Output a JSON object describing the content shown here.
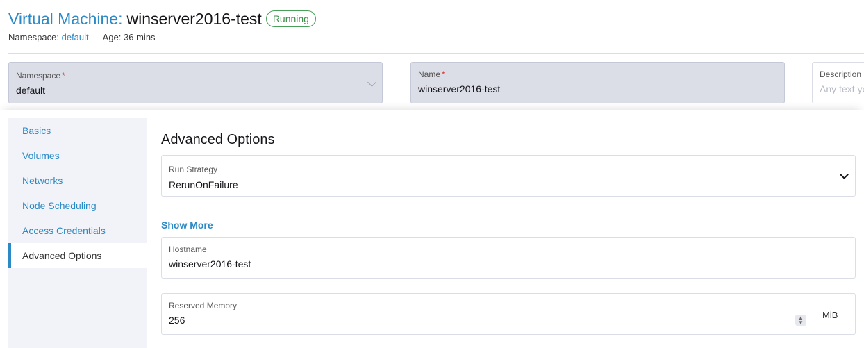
{
  "header": {
    "title_prefix": "Virtual Machine:",
    "vm_name": "winserver2016-test",
    "status": "Running",
    "namespace_label": "Namespace:",
    "namespace_value": "default",
    "age_label": "Age:",
    "age_value": "36 mins"
  },
  "top_fields": {
    "namespace": {
      "label": "Namespace",
      "required": "*",
      "value": "default"
    },
    "name": {
      "label": "Name",
      "required": "*",
      "value": "winserver2016-test"
    },
    "description": {
      "label": "Description",
      "placeholder": "Any text you want"
    }
  },
  "sidebar": {
    "items": [
      {
        "label": "Basics"
      },
      {
        "label": "Volumes"
      },
      {
        "label": "Networks"
      },
      {
        "label": "Node Scheduling"
      },
      {
        "label": "Access Credentials"
      },
      {
        "label": "Advanced Options",
        "active": true
      }
    ]
  },
  "content": {
    "title": "Advanced Options",
    "run_strategy": {
      "label": "Run Strategy",
      "value": "RerunOnFailure"
    },
    "show_more": "Show More",
    "hostname": {
      "label": "Hostname",
      "value": "winserver2016-test"
    },
    "reserved_memory": {
      "label": "Reserved Memory",
      "value": "256",
      "unit": "MiB"
    }
  },
  "colors": {
    "accent": "#2b8ac6",
    "status_green": "#3c8d4c",
    "required": "#d93737"
  }
}
